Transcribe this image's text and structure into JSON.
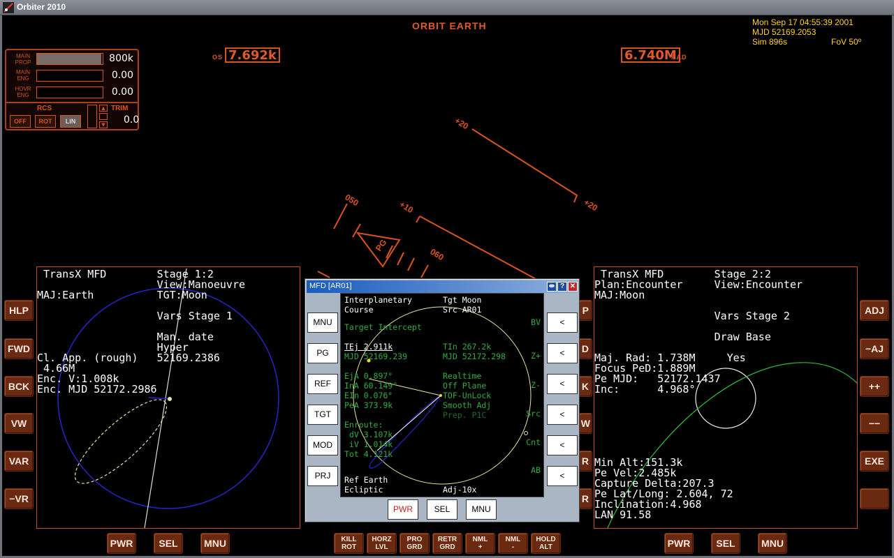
{
  "window": {
    "title": "Orbiter 2010"
  },
  "hud": {
    "mode": "ORBIT EARTH",
    "os_label": "OS",
    "os_value": "7.692k",
    "rad_value": "6.740M",
    "rad_label": "RAD",
    "ladder": [
      "+20",
      "+20",
      "050",
      "+10",
      "060",
      "PG"
    ]
  },
  "info": {
    "date": "Mon Sep 17 04:55:39 2001",
    "mjd": "MJD 52169.2053",
    "sim": "Sim  896s",
    "fov": "FoV  50º"
  },
  "engines": {
    "main_prop_label": "MAIN PROP",
    "main_prop_value": "800k",
    "main_prop_level": 0.98,
    "main_eng_label": "MAIN ENG",
    "main_eng_value": "0.00",
    "hovr_eng_label": "HOVR ENG",
    "hovr_eng_value": "0.00",
    "rcs_label": "RCS",
    "rcs_buttons": [
      "OFF",
      "ROT",
      "LIN"
    ],
    "trim_label": "TRIM",
    "trim_value": "0.0"
  },
  "left_mfd": {
    "lines": [
      " TransX MFD        Stage 1:2",
      "                   View:Manoeuvre",
      "MAJ:Earth          TGT:Moon",
      "",
      "                   Vars Stage 1",
      "",
      "                   Man. date",
      "                   Hyper",
      "Cl. App. (rough)   52169.2386",
      " 4.66M",
      "Enc. V:1.008k",
      "Enc. MJD 52172.2986"
    ],
    "left_buttons": [
      "HLP",
      "FWD",
      "BCK",
      "VW",
      "VAR",
      "−VR"
    ],
    "bottom_buttons": [
      "PWR",
      "SEL",
      "MNU"
    ]
  },
  "right_mfd": {
    "lines": [
      " TransX MFD        Stage 2:2",
      "Plan:Encounter     View:Encounter",
      "MAJ:Moon",
      "",
      "                   Vars Stage 2",
      "",
      "                   Draw Base",
      "",
      "Maj. Rad: 1.738M     Yes",
      "Focus PeD:1.889M",
      "Pe MJD:   52172.1437",
      "Inc:      4.968°"
    ],
    "bottom_lines": [
      "Min Alt:151.3k",
      "Pe Vel:2.485k",
      "Capture Delta:207.3",
      "Pe Lat/Long: 2.604, 72",
      "Inclination:4.968",
      "LAN 91.58"
    ],
    "right_buttons": [
      "ADJ",
      "−AJ",
      "++",
      "−−",
      "EXE",
      ""
    ],
    "bottom_buttons": [
      "PWR",
      "SEL",
      "MNU"
    ]
  },
  "dialog": {
    "title": "MFD [AR01]",
    "left_buttons": [
      "MNU",
      "PG",
      "REF",
      "TGT",
      "MOD",
      "PRJ"
    ],
    "right_buttons": [
      "<",
      "<",
      "<",
      "<",
      "<",
      "<"
    ],
    "bottom_buttons": [
      "PWR",
      "SEL",
      "MNU"
    ],
    "screen": {
      "title1": "Interplanetary",
      "title2": "Course",
      "tgt": "Tgt Moon",
      "src": "Src AR01",
      "target_intercept": "Target Intercept",
      "tej": "TEj 2.911k",
      "tej_mjd": "MJD 52169.239",
      "tin": "TIn 267.2k",
      "tin_mjd": "MJD 52172.298",
      "eja": "EjA 0.897°",
      "ina": "InA 60.149°",
      "ein": "EIn 0.076°",
      "pea": "PeA 373.9k",
      "realtime": "Realtime",
      "off_plane": "Off Plane",
      "tof": "TOF-UnLock",
      "smooth": "Smooth Adj",
      "prep": "Prep. P1C",
      "enroute": "Enroute:",
      "dv": " dV 3.107k",
      "iv": " iV 1.014k",
      "tot": "Tot 4.121k",
      "ref": "Ref Earth",
      "ecliptic": "Ecliptic",
      "adj": "Adj-10x",
      "side_labels": [
        "BV",
        "Z+",
        "Z-",
        "Src",
        "Cnt",
        "AB"
      ]
    }
  },
  "nav_buttons": [
    [
      "KILL",
      "ROT"
    ],
    [
      "HORZ",
      "LVL"
    ],
    [
      "PRO",
      "GRD"
    ],
    [
      "RETR",
      "GRD"
    ],
    [
      "NML",
      "+"
    ],
    [
      "NML",
      "-"
    ],
    [
      "HOLD",
      "ALT"
    ]
  ],
  "hidden_buttons": [
    "P",
    "D",
    "K",
    "W",
    "R",
    "R"
  ]
}
